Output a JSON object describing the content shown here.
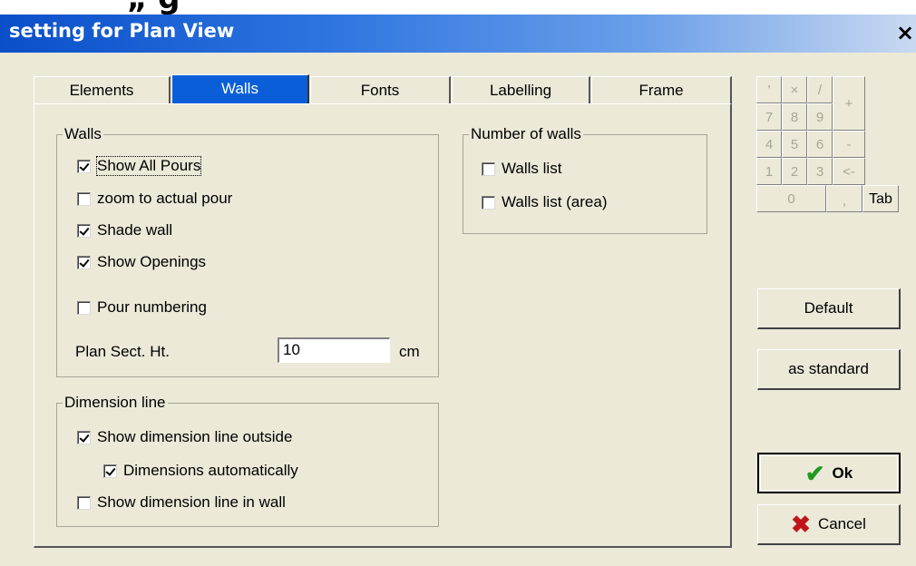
{
  "header_fragment": "„                        g",
  "window": {
    "title": "setting for Plan View",
    "close_glyph": "×"
  },
  "tabs": [
    {
      "label": "Elements"
    },
    {
      "label": "Walls"
    },
    {
      "label": "Fonts"
    },
    {
      "label": "Labelling"
    },
    {
      "label": "Frame"
    }
  ],
  "walls_group": {
    "legend": "Walls",
    "items": [
      {
        "label": "Show All Pours",
        "checked": true
      },
      {
        "label": "zoom to actual pour",
        "checked": false
      },
      {
        "label": "Shade wall",
        "checked": true
      },
      {
        "label": "Show Openings",
        "checked": true
      },
      {
        "label": "Pour numbering",
        "checked": false
      }
    ],
    "plan_sect_label": "Plan Sect. Ht.",
    "plan_sect_value": "10",
    "plan_sect_unit": "cm"
  },
  "dimension_group": {
    "legend": "Dimension line",
    "items": [
      {
        "label": "Show dimension line outside",
        "checked": true
      },
      {
        "label": "Dimensions automatically",
        "checked": true
      },
      {
        "label": "Show dimension line in wall",
        "checked": false
      }
    ]
  },
  "number_group": {
    "legend": "Number of walls",
    "items": [
      {
        "label": "Walls list",
        "checked": false
      },
      {
        "label": "Walls list (area)",
        "checked": false
      }
    ]
  },
  "keypad": {
    "keys": {
      "slash_left": "'",
      "times": "×",
      "divide": "/",
      "plus": "+",
      "k7": "7",
      "k8": "8",
      "k9": "9",
      "k4": "4",
      "k5": "5",
      "k6": "6",
      "minus": "-",
      "k1": "1",
      "k2": "2",
      "k3": "3",
      "back": "<-",
      "k0": "0",
      "dot": ",",
      "tab": "Tab"
    }
  },
  "buttons": {
    "default": "Default",
    "as_standard": "as standard",
    "ok": "Ok",
    "cancel": "Cancel"
  }
}
